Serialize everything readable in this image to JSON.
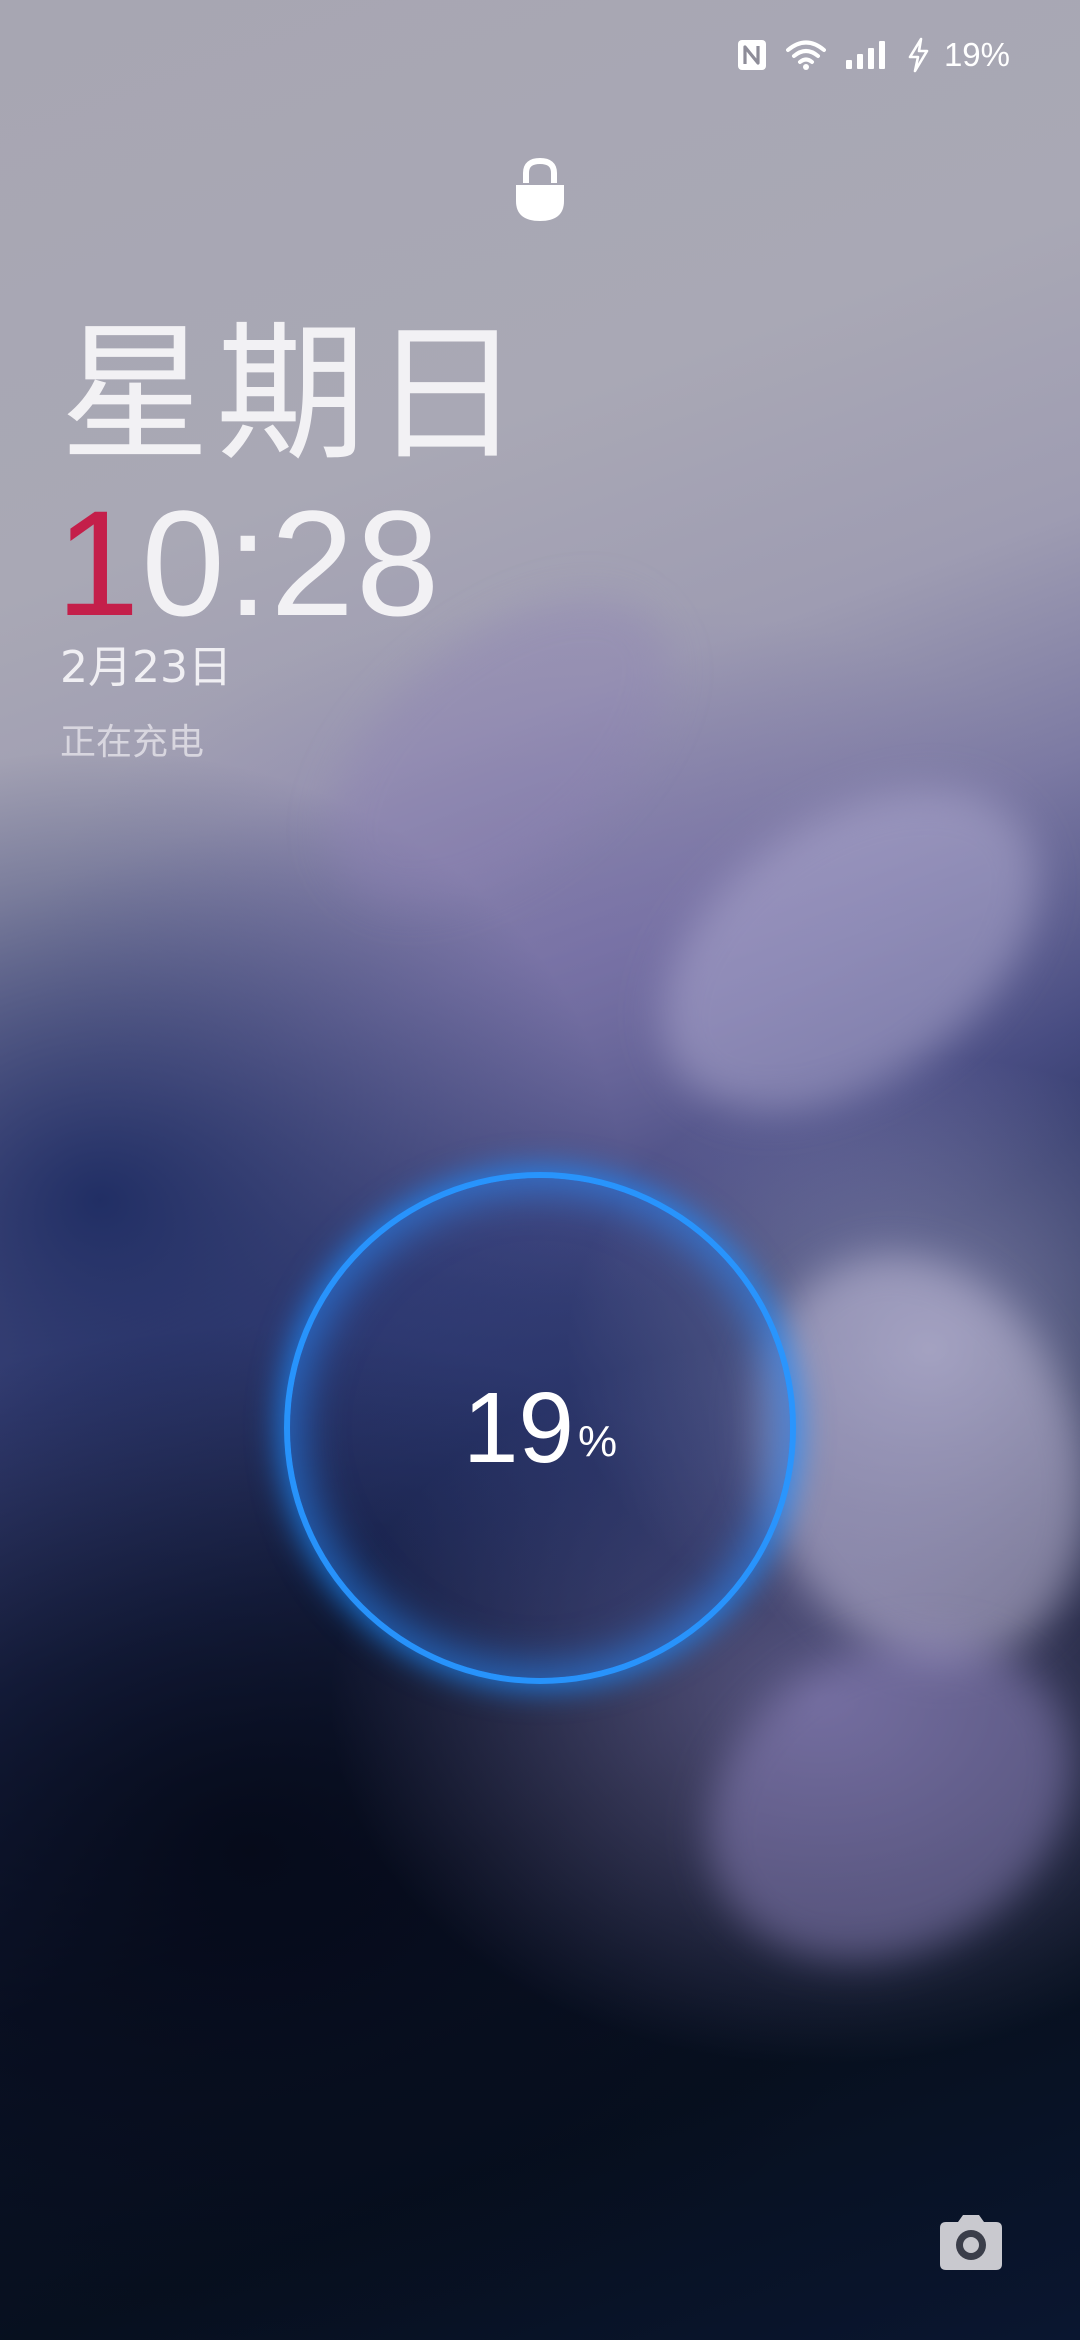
{
  "status_bar": {
    "icons": [
      "nfc-icon",
      "wifi-icon",
      "signal-icon",
      "charging-bolt-icon"
    ],
    "battery_text": "19%"
  },
  "lock_icon": "lock-icon",
  "clock": {
    "weekday": "星期日",
    "time_first_digit": "1",
    "time_rest": "0:28",
    "date": "2月23日",
    "status": "正在充电"
  },
  "charge": {
    "level_percent": 19,
    "number": "19",
    "unit": "%"
  },
  "camera_shortcut": "camera-icon",
  "colors": {
    "clock_accent": "#c41f4a",
    "ring_glow": "#2a96ff",
    "text": "#f2f1f4"
  }
}
